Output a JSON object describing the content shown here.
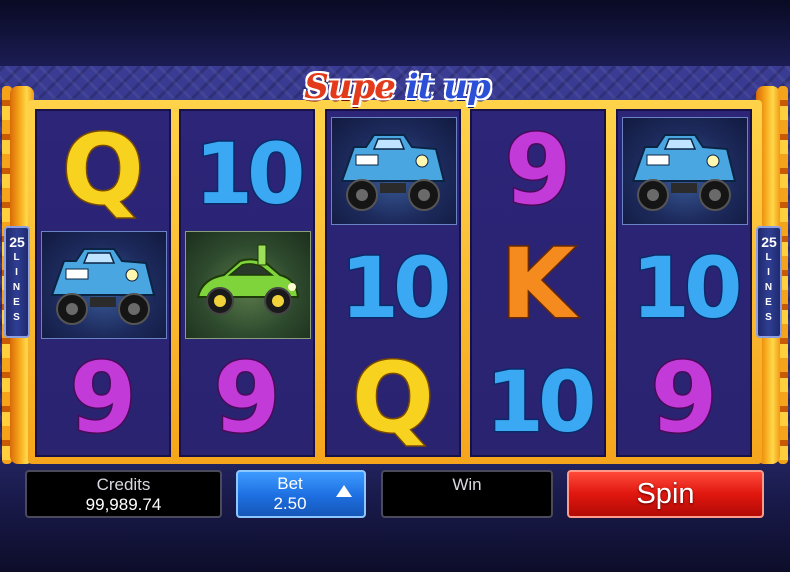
{
  "game": {
    "title_part1": "Supe",
    "title_part2": "it up"
  },
  "lines_badge": {
    "count": "25",
    "word": [
      "L",
      "I",
      "N",
      "E",
      "S"
    ]
  },
  "reels": [
    [
      {
        "symbol": "Q",
        "kind": "letter",
        "color": "#f7d21e",
        "outline": "#7a4a00"
      },
      {
        "symbol": "blue-monster-truck",
        "kind": "image"
      },
      {
        "symbol": "9",
        "kind": "letter",
        "color": "#c23ad8",
        "outline": "#4a0a5a"
      }
    ],
    [
      {
        "symbol": "10",
        "kind": "letter",
        "color": "#3aa8f2",
        "outline": "#0a2a6a"
      },
      {
        "symbol": "green-sports-car",
        "kind": "image"
      },
      {
        "symbol": "9",
        "kind": "letter",
        "color": "#c23ad8",
        "outline": "#4a0a5a"
      }
    ],
    [
      {
        "symbol": "blue-monster-truck",
        "kind": "image"
      },
      {
        "symbol": "10",
        "kind": "letter",
        "color": "#3aa8f2",
        "outline": "#0a2a6a"
      },
      {
        "symbol": "Q",
        "kind": "letter",
        "color": "#f7d21e",
        "outline": "#7a4a00"
      }
    ],
    [
      {
        "symbol": "9",
        "kind": "letter",
        "color": "#c23ad8",
        "outline": "#4a0a5a"
      },
      {
        "symbol": "K",
        "kind": "letter",
        "color": "#f58a1e",
        "outline": "#6a2a00"
      },
      {
        "symbol": "10",
        "kind": "letter",
        "color": "#3aa8f2",
        "outline": "#0a2a6a"
      }
    ],
    [
      {
        "symbol": "blue-monster-truck",
        "kind": "image"
      },
      {
        "symbol": "10",
        "kind": "letter",
        "color": "#3aa8f2",
        "outline": "#0a2a6a"
      },
      {
        "symbol": "9",
        "kind": "letter",
        "color": "#c23ad8",
        "outline": "#4a0a5a"
      }
    ]
  ],
  "panels": {
    "credits_label": "Credits",
    "credits_value": "99,989.74",
    "bet_label": "Bet",
    "bet_value": "2.50",
    "bet_icon": "triangle-up-icon",
    "win_label": "Win",
    "spin_label": "Spin"
  },
  "colors": {
    "spin": "#e0170f",
    "bet": "#1d6ee0",
    "frame": "#f5a51c",
    "reel_bg": "#2c2578"
  }
}
